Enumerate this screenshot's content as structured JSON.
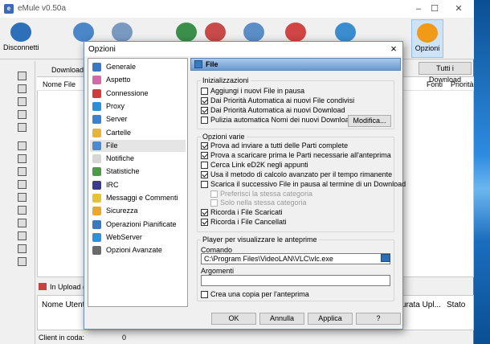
{
  "app": {
    "title": "eMule v0.50a"
  },
  "toolbar": {
    "items": [
      {
        "label": "Disconnetti",
        "color": "#2d6fb8"
      },
      {
        "label": "",
        "color": "#4a86c8"
      },
      {
        "label": "",
        "color": "#7a99c0"
      },
      {
        "label": "",
        "color": "#3b8f4b"
      },
      {
        "label": "",
        "color": "#c84a4a"
      },
      {
        "label": "",
        "color": "#5b8ec7"
      },
      {
        "label": "",
        "color": "#d04545"
      },
      {
        "label": "",
        "color": "#3a8ed0"
      },
      {
        "label": "Opzioni",
        "color": "#f09a18"
      }
    ]
  },
  "main": {
    "download_label": "Download (",
    "tutti_label": "Tutti i Download",
    "columns": {
      "nome": "Nome File",
      "fonti": "Fonti",
      "priorita": "Priorità"
    },
    "upload_label": "In Upload (",
    "upload_columns": {
      "nome": "Nome Utente",
      "durata": "urata Upl...",
      "stato": "Stato"
    },
    "client_label": "Client in coda:",
    "client_value": "0"
  },
  "dialog": {
    "title": "Opzioni",
    "close": "×",
    "nav": [
      {
        "label": "Generale",
        "color": "#3a78c2"
      },
      {
        "label": "Aspetto",
        "color": "#d06aa8"
      },
      {
        "label": "Connessione",
        "color": "#d23b3b"
      },
      {
        "label": "Proxy",
        "color": "#2f8fd6"
      },
      {
        "label": "Server",
        "color": "#3d7fd1"
      },
      {
        "label": "Cartelle",
        "color": "#e7b43a"
      },
      {
        "label": "File",
        "color": "#4c8ad0"
      },
      {
        "label": "Notifiche",
        "color": "#d6d6d6"
      },
      {
        "label": "Statistiche",
        "color": "#4e9a46"
      },
      {
        "label": "IRC",
        "color": "#3b3b88"
      },
      {
        "label": "Messaggi e Commenti",
        "color": "#e8c13c"
      },
      {
        "label": "Sicurezza",
        "color": "#e8a82c"
      },
      {
        "label": "Operazioni Pianificate",
        "color": "#3a78c2"
      },
      {
        "label": "WebServer",
        "color": "#2d92d8"
      },
      {
        "label": "Opzioni Avanzate",
        "color": "#6a6a6a"
      }
    ],
    "selected_nav": "File",
    "panel_title": "File",
    "inizializzazioni": {
      "legend": "Inizializzazioni",
      "options": [
        {
          "label": "Aggiungi i nuovi File in pausa",
          "checked": false
        },
        {
          "label": "Dai Priorità Automatica ai nuovi File condivisi",
          "checked": true
        },
        {
          "label": "Dai Priorità Automatica ai nuovi Download",
          "checked": true
        },
        {
          "label": "Pulizia automatica Nomi dei nuovi Download",
          "checked": false
        }
      ],
      "modifica_label": "Modifica..."
    },
    "opzioni_varie": {
      "legend": "Opzioni varie",
      "options": [
        {
          "label": "Prova ad inviare a tutti delle Parti complete",
          "checked": true
        },
        {
          "label": "Prova a scaricare prima le Parti necessarie all'anteprima",
          "checked": true
        },
        {
          "label": "Cerca Link eD2K negli appunti",
          "checked": false
        },
        {
          "label": "Usa il metodo di calcolo avanzato per il tempo rimanente",
          "checked": true
        },
        {
          "label": "Scarica il successivo File in pausa al termine di un Download",
          "checked": false
        },
        {
          "label": "Preferisci la stessa categoria",
          "checked": false,
          "disabled": true
        },
        {
          "label": "Solo nella stessa categoria",
          "checked": false,
          "disabled": true
        },
        {
          "label": "Ricorda i File Scaricati",
          "checked": true
        },
        {
          "label": "Ricorda i File Cancellati",
          "checked": true
        }
      ]
    },
    "player": {
      "legend": "Player per visualizzare le anteprime",
      "comando_label": "Comando",
      "comando_value": "C:\\Program Files\\VideoLAN\\VLC\\vlc.exe",
      "argomenti_label": "Argomenti",
      "argomenti_value": "",
      "copia": {
        "label": "Crea una copia per l'anteprima",
        "checked": false
      }
    },
    "buttons": {
      "ok": "OK",
      "annulla": "Annulla",
      "applica": "Applica",
      "help": "?"
    }
  }
}
